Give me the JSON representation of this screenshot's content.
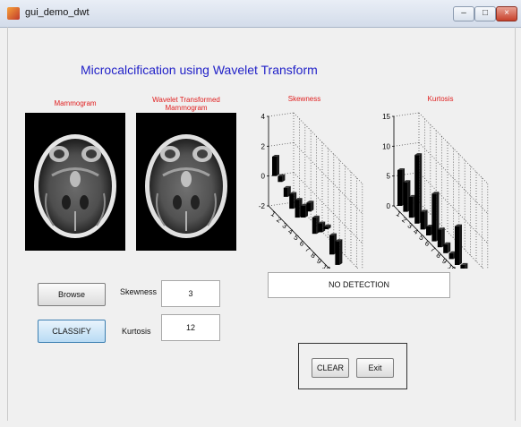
{
  "window": {
    "title": "gui_demo_dwt",
    "controls": [
      "minimize-icon",
      "maximize-icon",
      "close-icon"
    ]
  },
  "header": {
    "title": "Microcalcification  using Wavelet Transform"
  },
  "panels": {
    "mammogram_label": "Mammogram",
    "wavelet_label": "Wavelet Transformed Mammogram",
    "skewness_label": "Skewness",
    "kurtosis_label": "Kurtosis"
  },
  "chart_data": [
    {
      "type": "bar",
      "title": "Skewness",
      "xlabel": "",
      "ylabel": "",
      "categories": [
        "1",
        "2",
        "3",
        "4",
        "5",
        "6",
        "7",
        "8",
        "9",
        "10",
        "11",
        "12"
      ],
      "values": [
        1.3,
        0.4,
        -0.6,
        -1.0,
        -1.2,
        -0.8,
        0.6,
        -1.1,
        -0.6,
        0.2,
        -1.3,
        -1.6
      ],
      "ylim": [
        -2,
        4
      ],
      "yticks": [
        -2,
        0,
        2,
        4
      ],
      "grid": true,
      "style": "3d"
    },
    {
      "type": "bar",
      "title": "Kurtosis",
      "xlabel": "",
      "ylabel": "",
      "categories": [
        "1",
        "2",
        "3",
        "4",
        "5",
        "6",
        "7",
        "8",
        "9",
        "10",
        "11",
        "12"
      ],
      "values": [
        6.0,
        5.0,
        3.5,
        11.5,
        3.0,
        1.5,
        8.0,
        3.0,
        1.5,
        1.0,
        6.5,
        1.0
      ],
      "ylim": [
        0,
        15
      ],
      "yticks": [
        0,
        5,
        10,
        15
      ],
      "grid": true,
      "style": "3d"
    }
  ],
  "controls": {
    "browse_label": "Browse",
    "classify_label": "CLASSIFY",
    "skewness_label": "Skewness",
    "skewness_value": "3",
    "kurtosis_label": "Kurtosis",
    "kurtosis_value": "12",
    "result_text": "NO DETECTION",
    "clear_label": "CLEAR",
    "exit_label": "Exit"
  },
  "colors": {
    "heading": "#2222c8",
    "panel_label": "#e02020",
    "bar": "#000000"
  }
}
